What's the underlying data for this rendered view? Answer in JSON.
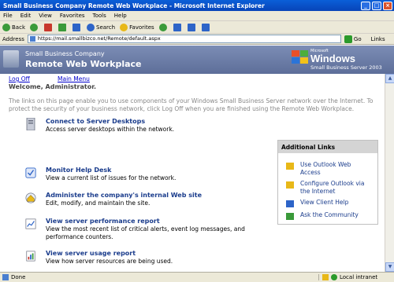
{
  "window": {
    "title": "Small Business Company Remote Web Workplace - Microsoft Internet Explorer"
  },
  "menu": [
    "File",
    "Edit",
    "View",
    "Favorites",
    "Tools",
    "Help"
  ],
  "toolbar": {
    "back": "Back",
    "search": "Search",
    "favorites": "Favorites"
  },
  "address": {
    "label": "Address",
    "url": "https://mail.smallbizco.net/Remote/default.aspx",
    "go": "Go",
    "links": "Links"
  },
  "header": {
    "company": "Small Business Company",
    "title": "Remote Web Workplace",
    "brand_small": "Microsoft",
    "brand_word": "Windows",
    "brand_product": "Small Business Server 2003"
  },
  "nav": {
    "logoff": "Log Off",
    "main_menu": "Main Menu"
  },
  "welcome": "Welcome, Administrator.",
  "intro": "The links on this page enable you to use components of your Windows Small Business Server network over the Internet. To protect the security of your business network, click Log Off when you are finished using the Remote Web Workplace.",
  "items": [
    {
      "title": "Connect to Server Desktops",
      "desc": "Access server desktops within the network."
    },
    {
      "title": "Monitor Help Desk",
      "desc": "View a current list of issues for the network."
    },
    {
      "title": "Administer the company's internal Web site",
      "desc": "Edit, modify, and maintain the site."
    },
    {
      "title": "View server performance report",
      "desc": "View the most recent list of critical alerts, event log messages, and",
      "desc2": "performance counters."
    },
    {
      "title": "View server usage report",
      "desc": "View how server resources are being used."
    }
  ],
  "panel": {
    "title": "Additional Links",
    "links": [
      {
        "l1": "Use Outlook Web",
        "l2": "Access"
      },
      {
        "l1": "Configure Outlook via",
        "l2": "the Internet"
      },
      {
        "l1": "View Client Help",
        "l2": ""
      },
      {
        "l1": "Ask the Community",
        "l2": ""
      }
    ]
  },
  "status": {
    "left": "Done",
    "zone": "Local intranet"
  },
  "colors": {
    "title_bar": "#0a5fd8",
    "header": "#6f80a9",
    "link": "#1a3c8c",
    "panel_header": "#d4d4d4"
  }
}
